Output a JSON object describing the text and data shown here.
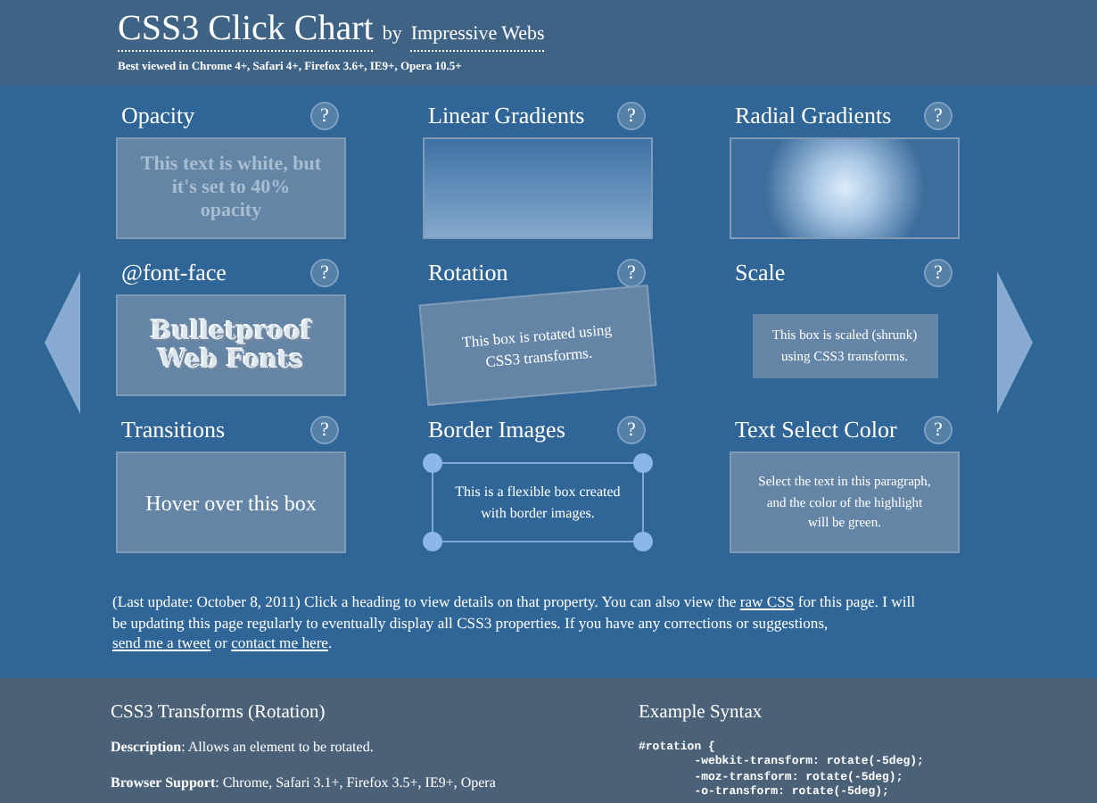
{
  "header": {
    "title": "CSS3 Click Chart",
    "by": "by",
    "author_link": "Impressive Webs",
    "subtitle": "Best viewed in Chrome 4+, Safari 4+, Firefox 3.6+, IE9+, Opera 10.5+"
  },
  "cards": [
    {
      "heading": "Opacity",
      "help": "?",
      "kind": "faded",
      "text": "This text is white, but it's set to 40% opacity"
    },
    {
      "heading": "Linear Gradients",
      "help": "?",
      "kind": "linear"
    },
    {
      "heading": "Radial Gradients",
      "help": "?",
      "kind": "radial"
    },
    {
      "heading": "@font-face",
      "help": "?",
      "kind": "fontface",
      "text": "Bulletproof Web Fonts"
    },
    {
      "heading": "Rotation",
      "help": "?",
      "kind": "rotated",
      "text": "This box is rotated using CSS3 transforms."
    },
    {
      "heading": "Scale",
      "help": "?",
      "kind": "scaled",
      "text": "This box is scaled (shrunk) using CSS3 transforms."
    },
    {
      "heading": "Transitions",
      "help": "?",
      "kind": "hover",
      "text": "Hover over this box"
    },
    {
      "heading": "Border Images",
      "help": "?",
      "kind": "border",
      "text": "This is a flexible box created with border images."
    },
    {
      "heading": "Text Select Color",
      "help": "?",
      "kind": "plain",
      "text": "Select the text in this paragraph, and the color of the highlight will be green."
    }
  ],
  "note": [
    {
      "kind": "text",
      "text": "(Last update: October 8, 2011) Click a heading to view details on that property. You can also view the"
    },
    {
      "kind": "link",
      "text": "raw CSS"
    },
    {
      "kind": "text",
      "text": "for this page. I will be updating this page regularly to eventually display all CSS3 properties. If you have any corrections or suggestions,"
    },
    {
      "kind": "link",
      "text": "send me a tweet"
    },
    {
      "kind": "text",
      "text": "or"
    },
    {
      "kind": "link",
      "text": "contact me here"
    },
    {
      "kind": "text",
      "text": "."
    }
  ],
  "details": {
    "title": "CSS3 Transforms (Rotation)",
    "lines": [
      "**Description**: Allows an element to be rotated.",
      "**Browser Support**: Chrome, Safari 3.1+, Firefox 3.5+, IE9+, Opera"
    ]
  },
  "syntax": {
    "title": "Example Syntax",
    "code": [
      "#rotation {",
      "        -webkit-transform: rotate(-5deg);",
      "        -moz-transform: rotate(-5deg);",
      "        -o-transform: rotate(-5deg);"
    ]
  }
}
